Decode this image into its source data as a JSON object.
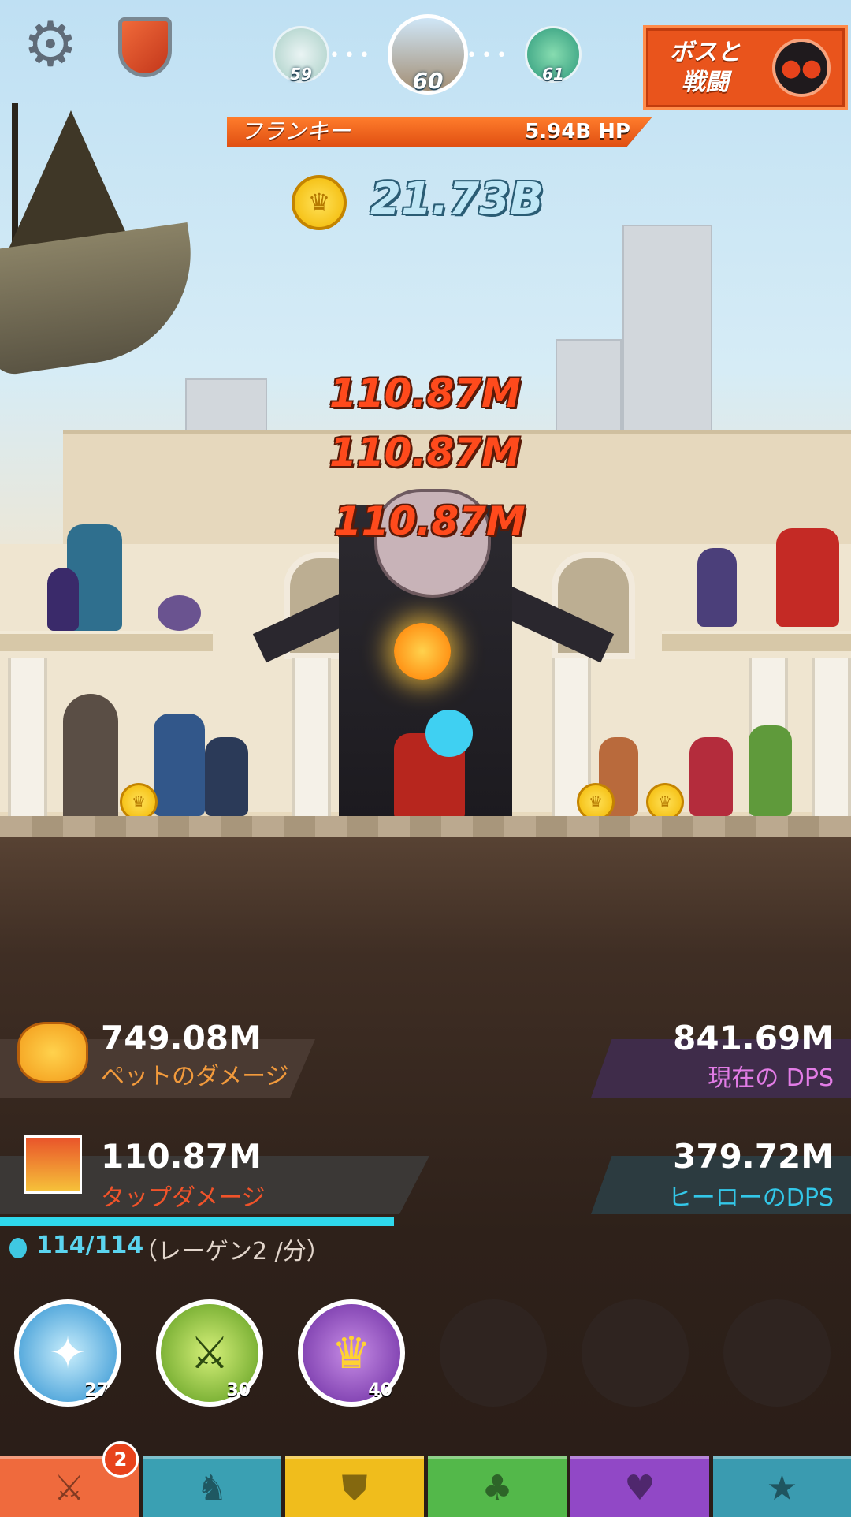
{
  "topbar": {
    "settings_icon": "gear-icon",
    "clan_icon": "shield-icon",
    "stages": [
      {
        "number": "59"
      },
      {
        "number": "60",
        "current": true
      },
      {
        "number": "61"
      }
    ],
    "boss_button_line1": "ボスと",
    "boss_button_line2": "戦闘"
  },
  "enemy": {
    "name": "フランキー",
    "hp": "5.94B HP",
    "hp_fraction": 1.0
  },
  "gold": {
    "amount": "21.73B"
  },
  "damage_popups": [
    "110.87M",
    "110.87M",
    "110.87M"
  ],
  "stats": {
    "pet_damage_value": "749.08M",
    "pet_damage_label": "ペットのダメージ",
    "current_dps_value": "841.69M",
    "current_dps_label": "現在の DPS",
    "tap_damage_value": "110.87M",
    "tap_damage_label": "タップダメージ",
    "hero_dps_value": "379.72M",
    "hero_dps_label": "ヒーローのDPS"
  },
  "mana": {
    "current": "114/114",
    "regen": "（レーゲン2 /分）",
    "fraction": 1.0
  },
  "skills": [
    {
      "name": "heavenly-strike",
      "level": "27"
    },
    {
      "name": "deadly-strike",
      "level": "30"
    },
    {
      "name": "hand-of-midas",
      "level": "40"
    },
    {
      "name": "empty"
    },
    {
      "name": "empty"
    },
    {
      "name": "empty"
    }
  ],
  "tabs": [
    {
      "name": "sword",
      "badge": "2",
      "color": "#ef6a3d"
    },
    {
      "name": "heroes",
      "color": "#3aa0b3"
    },
    {
      "name": "equipment",
      "color": "#f0bd1c"
    },
    {
      "name": "pets",
      "color": "#53b84a"
    },
    {
      "name": "artifacts",
      "color": "#9148c6"
    },
    {
      "name": "shop",
      "color": "#3a9bb0"
    }
  ]
}
